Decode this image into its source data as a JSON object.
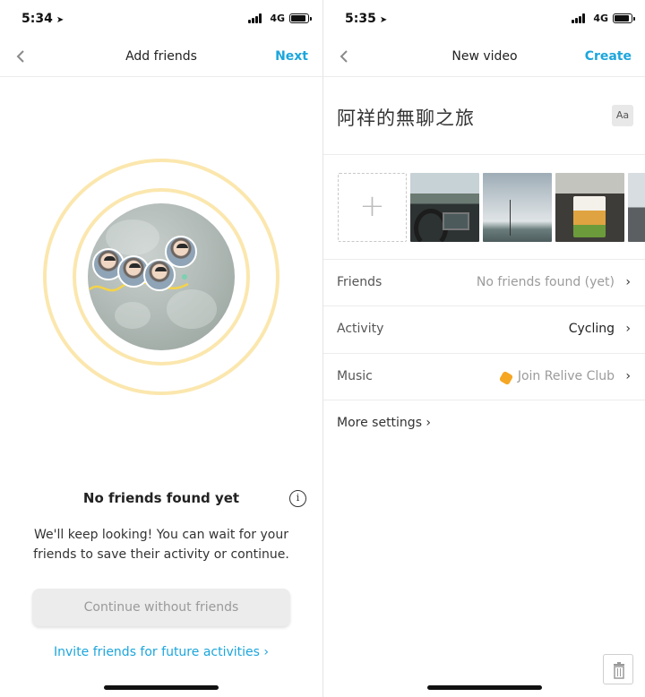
{
  "left": {
    "status": {
      "time": "5:34",
      "network": "4G"
    },
    "nav": {
      "back_label": "<",
      "title": "Add friends",
      "next_label": "Next"
    },
    "empty_state": {
      "title": "No friends found yet",
      "info_label": "i",
      "body": "We'll keep looking! You can wait for your friends to save their activity or continue.",
      "continue_label": "Continue without friends",
      "invite_label": "Invite friends for future activities ›"
    }
  },
  "right": {
    "status": {
      "time": "5:35",
      "network": "4G"
    },
    "nav": {
      "back_label": "<",
      "title": "New video",
      "create_label": "Create"
    },
    "video_title": "阿祥的無聊之旅",
    "font_button_label": "Aa",
    "add_media_label": "+",
    "settings": [
      {
        "label": "Friends",
        "value": "No friends found (yet)"
      },
      {
        "label": "Activity",
        "value": "Cycling"
      },
      {
        "label": "Music",
        "value": "Join Relive Club"
      }
    ],
    "more_settings_label": "More settings ›",
    "chevron": "›"
  },
  "colors": {
    "accent": "#1ca6dc",
    "ring": "#fbe7ae",
    "club": "#f5a623"
  },
  "icons": [
    "location-arrow-icon",
    "signal-icon",
    "battery-icon",
    "chevron-left-icon",
    "info-icon",
    "chevron-right-icon",
    "relive-club-icon",
    "trash-icon"
  ]
}
